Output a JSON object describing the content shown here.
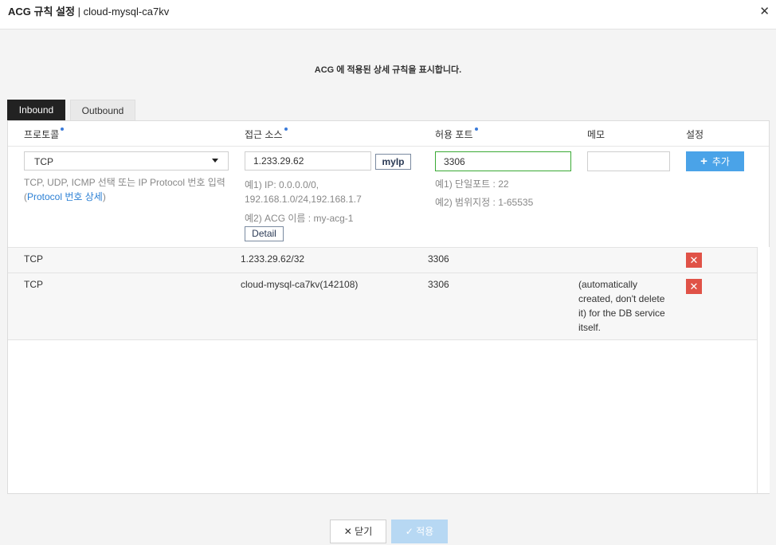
{
  "header": {
    "title_main": "ACG 규칙 설정",
    "title_sep": " | ",
    "title_sub": "cloud-mysql-ca7kv",
    "close_icon": "close-icon"
  },
  "description": "ACG 에 적용된 상세 규칙을 표시합니다.",
  "tabs": [
    {
      "label": "Inbound",
      "active": true
    },
    {
      "label": "Outbound",
      "active": false
    }
  ],
  "columns": {
    "protocol": "프로토콜",
    "source": "접근 소스",
    "port": "허용 포트",
    "memo": "메모",
    "settings": "설정"
  },
  "form": {
    "protocol_value": "TCP",
    "protocol_hint_1": "TCP, UDP, ICMP 선택 또는 IP Protocol 번호 입력",
    "protocol_hint_open": "(",
    "protocol_hint_link": "Protocol 번호 상세",
    "protocol_hint_close": ")",
    "source_value": "1.233.29.62",
    "myip_label": "myIp",
    "source_hint_1": "예1) IP: 0.0.0.0/0,",
    "source_hint_2": "192.168.1.0/24,192.168.1.7",
    "source_hint_3": "예2) ACG 이름 : my-acg-1",
    "detail_label": "Detail",
    "port_value": "3306",
    "port_hint_1": "예1) 단일포트 : 22",
    "port_hint_2": "예2) 범위지정 : 1-65535",
    "memo_value": "",
    "add_label": "추가"
  },
  "rules": [
    {
      "protocol": "TCP",
      "source": "1.233.29.62/32",
      "port": "3306",
      "memo": ""
    },
    {
      "protocol": "TCP",
      "source": "cloud-mysql-ca7kv(142108)",
      "port": "3306",
      "memo_lines": [
        "(automatically",
        "created, don't delete",
        "it) for the DB service",
        "itself."
      ]
    }
  ],
  "footer": {
    "close_label": "닫기",
    "apply_label": "적용"
  },
  "colors": {
    "accent": "#4aa3e8",
    "delete": "#e05247",
    "port_border": "#3aaa35",
    "link": "#2a7fd4"
  }
}
